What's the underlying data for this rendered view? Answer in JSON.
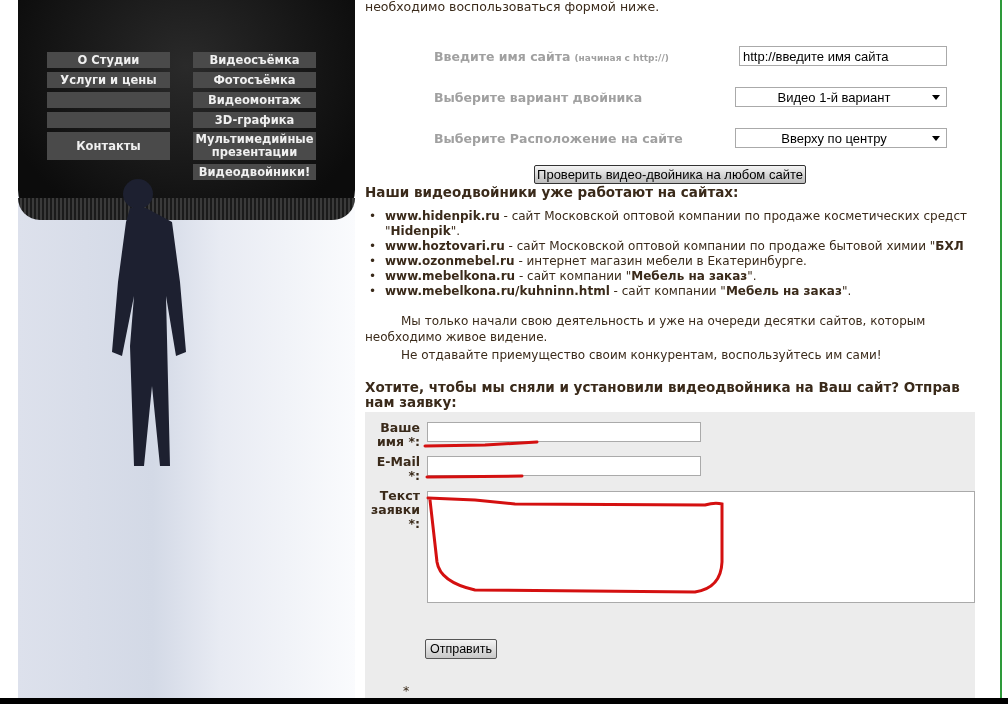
{
  "menu": {
    "left": [
      {
        "kind": "link",
        "label": "О Студии",
        "tall": false
      },
      {
        "kind": "link",
        "label": "Услуги и цены",
        "tall": false
      },
      {
        "kind": "blank",
        "tall": false
      },
      {
        "kind": "blank",
        "tall": false
      },
      {
        "kind": "link",
        "label": "Контакты",
        "tall": true
      }
    ],
    "right": [
      {
        "kind": "link",
        "label": "Видеосъёмка",
        "tall": false
      },
      {
        "kind": "link",
        "label": "Фотосъёмка",
        "tall": false
      },
      {
        "kind": "link",
        "label": "Видеомонтаж",
        "tall": false
      },
      {
        "kind": "link",
        "label": "3D-графика",
        "tall": false
      },
      {
        "kind": "link",
        "label": "Мультимедийные презентации",
        "tall": true
      },
      {
        "kind": "link",
        "label": "Видеодвойники!",
        "tall": false
      }
    ]
  },
  "intro": "необходимо воспользоваться формой ниже.",
  "check_form": {
    "fields": [
      {
        "kind": "input",
        "label": "Введите имя сайта",
        "hint": "(начиная с http://)",
        "value": "http://введите имя сайта"
      },
      {
        "kind": "select",
        "label": "Выберите вариант двойника",
        "value": "Видео 1-й вариант"
      },
      {
        "kind": "select",
        "label": "Выберите Расположение на сайте",
        "value": "Вверху по центру"
      }
    ],
    "button": "Проверить видео-двойника на любом сайте"
  },
  "sites_heading": "Наши видеодвойники уже работают на сайтах:",
  "sites": [
    {
      "bullet": "•",
      "lines": [
        "**www.hidenpik.ru** - сайт Московской оптовой компании по продаже косметических средст",
        "\"**Hidenpik**\"."
      ]
    },
    {
      "bullet": "•",
      "lines": [
        "**www.hoztovari.ru** - сайт Московской оптовой компании по продаже бытовой химии \"**БХЛ**"
      ]
    },
    {
      "bullet": "•",
      "lines": [
        "**www.ozonmebel.ru** - интернет магазин мебели в Екатеринбурге."
      ]
    },
    {
      "bullet": "•",
      "lines": [
        "**www.mebelkona.ru** - сайт компании \"**Мебель на заказ**\"."
      ]
    },
    {
      "bullet": "•",
      "lines": [
        "**www.mebelkona.ru/kuhninn.html** - сайт компании \"**Мебель на заказ**\"."
      ]
    }
  ],
  "paragraphs": [
    "Мы только начали свою деятельность и уже на очереди десятки сайтов, которым необходимо живое видение.",
    "Не отдавайте приемущество своим конкурентам, воспользуйтесь им сами!"
  ],
  "order_heading": [
    "Хотите, чтобы мы сняли и установили видеодвойника на Ваш сайт? Отправ",
    "нам заявку:"
  ],
  "order_form": {
    "fields": [
      {
        "kind": "input",
        "label": "Ваше имя *:"
      },
      {
        "kind": "input",
        "label": "E-Mail *:"
      },
      {
        "kind": "textarea",
        "label": "Текст заявки *:"
      }
    ],
    "button": "Отправить",
    "footnote": "*"
  }
}
